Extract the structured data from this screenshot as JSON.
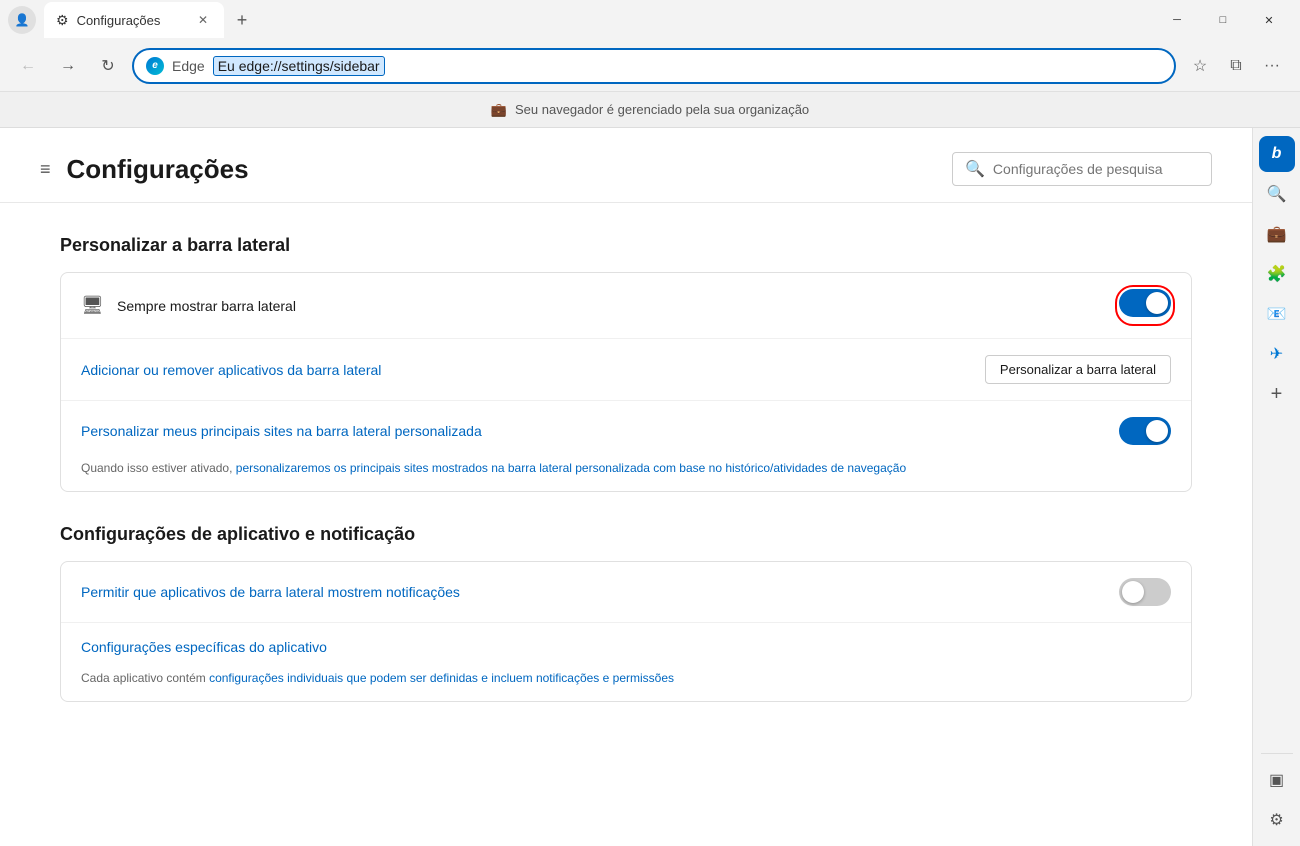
{
  "titleBar": {
    "tab": {
      "icon": "⚙",
      "title": "Configurações",
      "close": "✕"
    },
    "newTab": "+",
    "windowControls": {
      "minimize": "─",
      "maximize": "□",
      "close": "✕"
    }
  },
  "navBar": {
    "back": "←",
    "forward": "→",
    "refresh": "↻",
    "addressBar": {
      "edgeLabel": "Edge",
      "urlLabel": "Eu edge://settings/sidebar"
    },
    "favorite": "☆",
    "collections": "⧉",
    "more": "···"
  },
  "managedBanner": {
    "icon": "💼",
    "text": "Seu navegador é gerenciado pela sua organização"
  },
  "settings": {
    "menuIcon": "≡",
    "title": "Configurações",
    "search": {
      "placeholder": "Configurações de pesquisa"
    },
    "sections": [
      {
        "id": "sidebar-section",
        "title": "Personalizar a barra lateral",
        "rows": [
          {
            "id": "always-show-sidebar",
            "icon": "🖥",
            "label": "Sempre mostrar barra lateral",
            "toggleOn": true,
            "highlighted": true
          },
          {
            "id": "add-remove-apps",
            "label": "Adicionar ou remover aplicativos da barra lateral",
            "buttonLabel": "Personalizar a barra lateral"
          },
          {
            "id": "personalize-sites",
            "label": "Personalizar meus principais sites na barra lateral personalizada",
            "sublabel": "Quando isso estiver ativado,  personalizaremos os principais sites mostrados na barra lateral personalizada com base no histórico/atividades de navegação",
            "sublabelBlue": "personalizaremos os principais sites mostrados na barra lateral personalizada com base no histórico/atividades de navegação",
            "toggleOn": true
          }
        ]
      },
      {
        "id": "app-notification-section",
        "title": "Configurações de aplicativo e notificação",
        "rows": [
          {
            "id": "allow-notifications",
            "label": "Permitir que aplicativos de barra lateral mostrem notificações",
            "toggleOn": false
          },
          {
            "id": "app-specific-settings",
            "label": "Configurações específicas do aplicativo",
            "sublabel": "Cada aplicativo contém configurações individuais que podem ser definidas e incluem notificações e permissões",
            "sublabelBlue": "configurações individuais que podem ser definidas e incluem notificações e permissões"
          }
        ]
      }
    ]
  },
  "rightSidebar": {
    "items": [
      {
        "id": "bing",
        "icon": "b",
        "label": "Bing",
        "active": true,
        "style": "bing"
      },
      {
        "id": "search",
        "icon": "🔍",
        "label": "Search"
      },
      {
        "id": "briefcase",
        "icon": "💼",
        "label": "Collections"
      },
      {
        "id": "extension",
        "icon": "🧩",
        "label": "Extensions"
      },
      {
        "id": "outlook",
        "icon": "📧",
        "label": "Outlook"
      },
      {
        "id": "send",
        "icon": "✈",
        "label": "Send"
      },
      {
        "id": "add",
        "icon": "+",
        "label": "Add"
      }
    ],
    "bottomItems": [
      {
        "id": "tab-view",
        "icon": "▣",
        "label": "Tab view"
      },
      {
        "id": "settings",
        "icon": "⚙",
        "label": "Settings"
      }
    ]
  }
}
